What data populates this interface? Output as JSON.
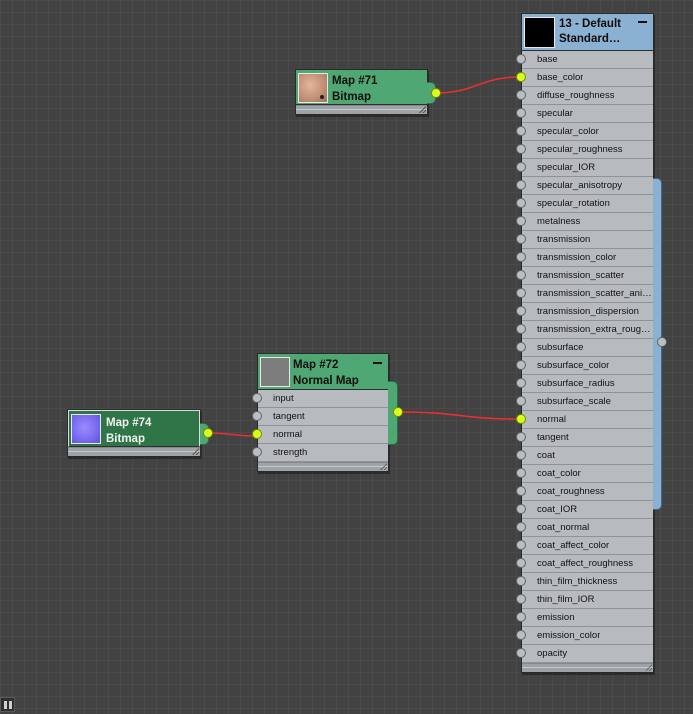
{
  "colors": {
    "canvas": "#424242",
    "bitmap_node": "#4fa873",
    "normal_map_node": "#4fa873",
    "material_header": "#8ab0d2",
    "slot_bg": "#b7bbbf",
    "socket_connected": "#d9ff1c",
    "wire": "#e8302e"
  },
  "nodes": {
    "map71": {
      "title_line1": "Map #71",
      "title_line2": "Bitmap",
      "thumbnail": "skin-texture-thumbnail"
    },
    "map74": {
      "title_line1": "Map #74",
      "title_line2": "Bitmap",
      "thumbnail": "normal-map-texture-thumbnail"
    },
    "map72": {
      "title_line1": "Map #72",
      "title_line2": "Normal Map",
      "thumbnail": "grey-swatch-thumbnail",
      "slots": [
        "input",
        "tangent",
        "normal",
        "strength"
      ],
      "connected_slots": [
        "normal"
      ]
    },
    "material": {
      "title_line1": "13 - Default",
      "title_line2": "Standard…",
      "thumbnail": "black-swatch-thumbnail",
      "slots": [
        "base",
        "base_color",
        "diffuse_roughness",
        "specular",
        "specular_color",
        "specular_roughness",
        "specular_IOR",
        "specular_anisotropy",
        "specular_rotation",
        "metalness",
        "transmission",
        "transmission_color",
        "transmission_scatter",
        "transmission_scatter_ani…",
        "transmission_dispersion",
        "transmission_extra_roug…",
        "subsurface",
        "subsurface_color",
        "subsurface_radius",
        "subsurface_scale",
        "normal",
        "tangent",
        "coat",
        "coat_color",
        "coat_roughness",
        "coat_IOR",
        "coat_normal",
        "coat_affect_color",
        "coat_affect_roughness",
        "thin_film_thickness",
        "thin_film_IOR",
        "emission",
        "emission_color",
        "opacity"
      ],
      "connected_slots": [
        "base_color",
        "normal"
      ]
    }
  },
  "connections": [
    {
      "from": "Map #71",
      "to": "13 - Default.base_color"
    },
    {
      "from": "Map #74",
      "to": "Map #72.normal"
    },
    {
      "from": "Map #72",
      "to": "13 - Default.normal"
    }
  ],
  "status_icon": "quick-help-icon"
}
